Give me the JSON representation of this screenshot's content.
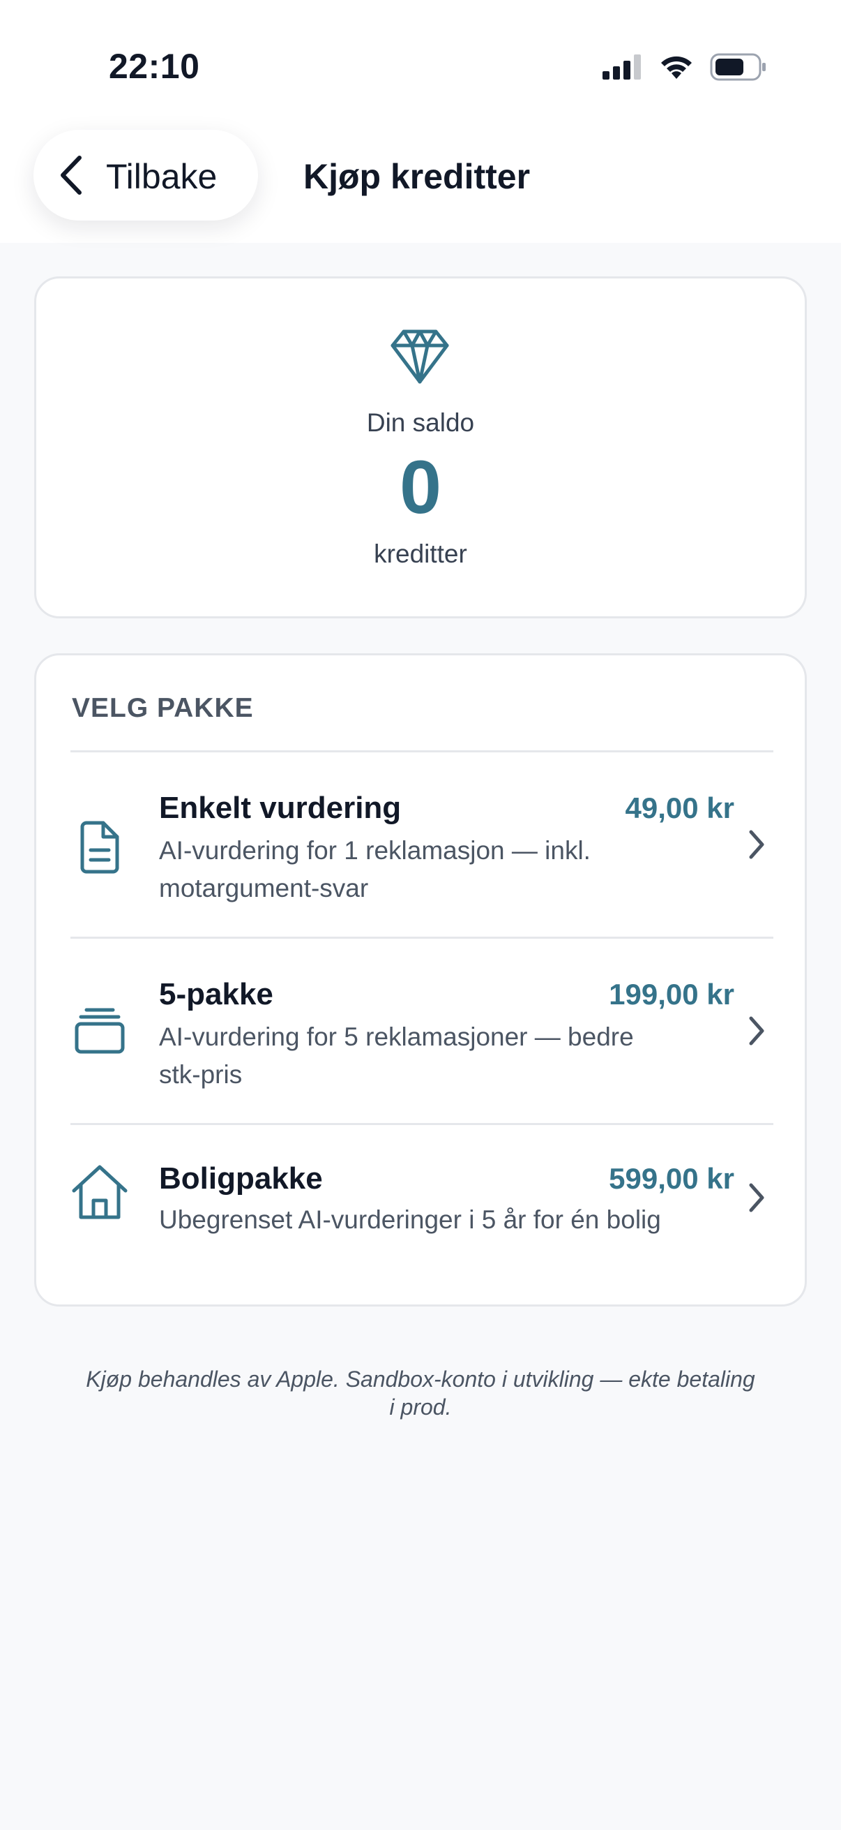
{
  "status_bar": {
    "time": "22:10",
    "icons": [
      "cellular-signal-icon",
      "wifi-icon",
      "battery-icon"
    ]
  },
  "nav": {
    "back_label": "Tilbake",
    "title": "Kjøp kreditter"
  },
  "balance": {
    "icon": "diamond-icon",
    "label": "Din saldo",
    "value": "0",
    "unit": "kreditter"
  },
  "packages": {
    "section_title": "VELG PAKKE",
    "items": [
      {
        "icon": "document-icon",
        "name": "Enkelt vurdering",
        "price": "49,00 kr",
        "description": "AI-vurdering for 1 reklamasjon — inkl. motargument-svar"
      },
      {
        "icon": "stack-icon",
        "name": "5-pakke",
        "price": "199,00 kr",
        "description": "AI-vurdering for 5 reklamasjoner — bedre stk-pris"
      },
      {
        "icon": "house-icon",
        "name": "Boligpakke",
        "price": "599,00 kr",
        "description": "Ubegrenset AI-vurderinger i 5 år for én bolig"
      }
    ]
  },
  "footer": {
    "note": "Kjøp behandles av Apple. Sandbox-konto i utvikling — ekte betaling i prod."
  },
  "colors": {
    "accent": "#35738a",
    "background": "#f8f9fb",
    "card": "#ffffff",
    "border": "#e5e7eb"
  }
}
